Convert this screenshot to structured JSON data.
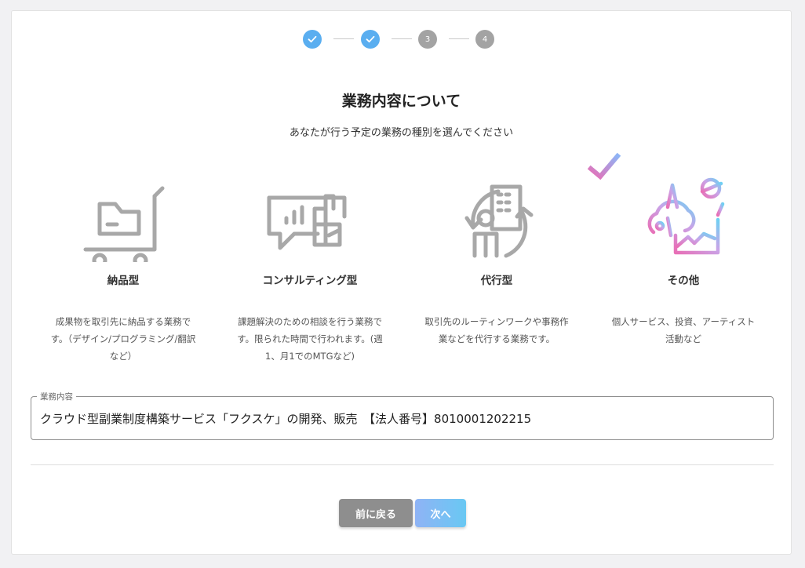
{
  "stepper": {
    "steps": [
      {
        "state": "done",
        "label": ""
      },
      {
        "state": "done",
        "label": ""
      },
      {
        "state": "todo",
        "label": "3"
      },
      {
        "state": "todo",
        "label": "4"
      }
    ]
  },
  "heading": {
    "title": "業務内容について",
    "subtitle": "あなたが行う予定の業務の種別を選んでください"
  },
  "options": [
    {
      "icon": "delivery-cart-icon",
      "label": "納品型",
      "description": "成果物を取引先に納品する業務です。（デザイン/プログラミング/翻訳など）",
      "selected": false
    },
    {
      "icon": "consulting-chat-icon",
      "label": "コンサルティング型",
      "description": "課題解決のための相談を行う業務です。限られた時間で行われます。(週1、月1でのMTGなど)",
      "selected": false
    },
    {
      "icon": "agency-cycle-icon",
      "label": "代行型",
      "description": "取引先のルーティンワークや事務作業などを代行する業務です。",
      "selected": false
    },
    {
      "icon": "other-activities-icon",
      "label": "その他",
      "description": "個人サービス、投資、アーティスト活動など",
      "selected": true
    }
  ],
  "business_field": {
    "legend": "業務内容",
    "value": "クラウド型副業制度構築サービス「フクスケ」の開発、販売　【法人番号】8010001202215"
  },
  "buttons": {
    "back_label": "前に戻る",
    "next_label": "次へ"
  },
  "colors": {
    "step_done": "#5aaef0",
    "step_todo": "#a3a3a3",
    "icon_gray": "#a8a8a8",
    "accent_gradient_start": "#8fb3f5",
    "accent_gradient_end": "#69c8f3",
    "selected_gradient_pink": "#e86fb6",
    "selected_gradient_blue": "#8fb3f5"
  }
}
